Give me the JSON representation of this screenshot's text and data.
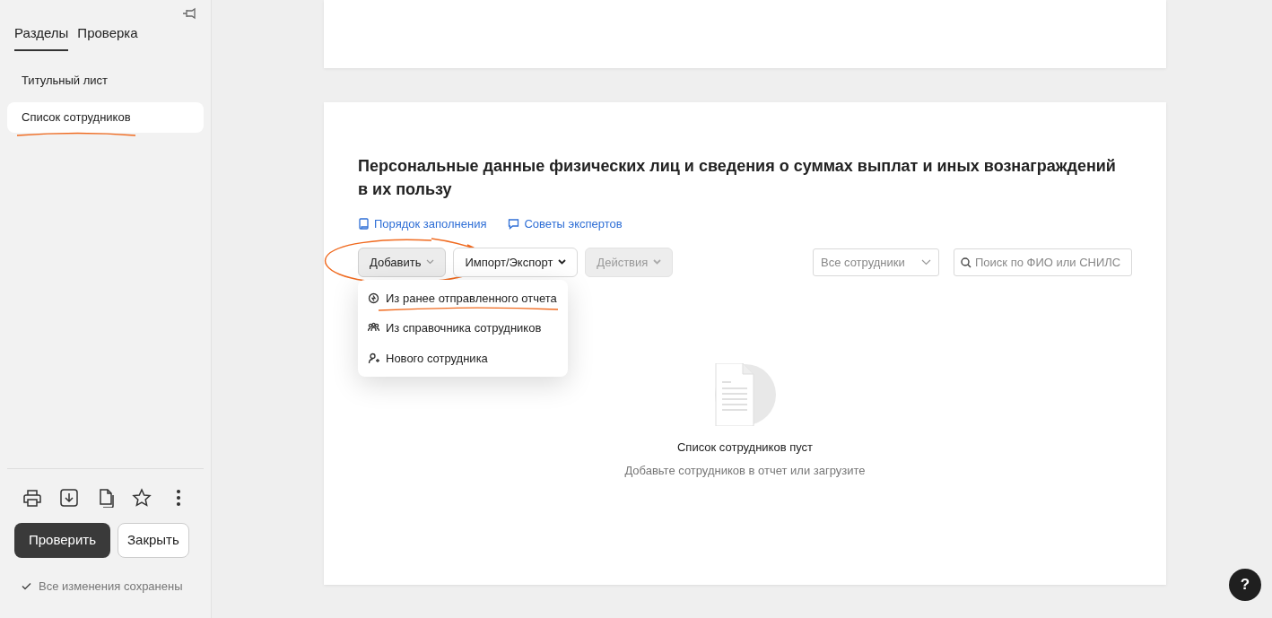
{
  "sidebar": {
    "tabs": [
      {
        "label": "Разделы",
        "selected": true
      },
      {
        "label": "Проверка",
        "selected": false
      }
    ],
    "items": [
      {
        "label": "Титульный лист",
        "selected": false
      },
      {
        "label": "Список сотрудников",
        "selected": true
      }
    ],
    "primary_button": "Проверить",
    "secondary_button": "Закрыть",
    "save_status": "Все изменения сохранены"
  },
  "section": {
    "title": "Персональные данные физических лиц и сведения о суммах выплат и иных вознаграждений в их пользу",
    "links": [
      {
        "label": "Порядок заполнения",
        "kind": "book"
      },
      {
        "label": "Советы экспертов",
        "kind": "chat"
      }
    ],
    "toolbar": [
      {
        "label": "Добавить",
        "expanded": true,
        "disabled": false
      },
      {
        "label": "Импорт/Экспорт",
        "expanded": false,
        "disabled": false
      },
      {
        "label": "Действия",
        "expanded": false,
        "disabled": true
      }
    ],
    "add_menu": [
      {
        "label": "Из ранее отправленного отчета",
        "kind": "report"
      },
      {
        "label": "Из справочника сотрудников",
        "kind": "directory"
      },
      {
        "label": "Нового сотрудника",
        "kind": "person"
      }
    ],
    "filter": {
      "value": "Все сотрудники"
    },
    "search": {
      "placeholder": "Поиск по ФИО или СНИЛС"
    },
    "empty_title": "Список сотрудников пуст",
    "empty_text": "Добавьте сотрудников в отчет или загрузите"
  },
  "help_button": "?"
}
